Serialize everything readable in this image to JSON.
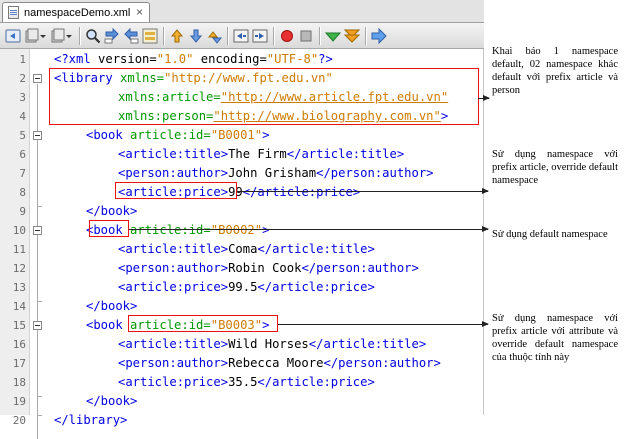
{
  "tab": {
    "title": "namespaceDemo.xml",
    "close": "×"
  },
  "toolbar": {
    "icons": [
      "back-icon",
      "history-icon",
      "forward-icon",
      "find-icon",
      "prev-occurrence-icon",
      "next-occurrence-icon",
      "toggle-selection-icon",
      "prev-bookmark-icon",
      "next-bookmark-icon",
      "toggle-bookmark-icon",
      "shift-left-icon",
      "shift-right-icon",
      "record-macro-icon",
      "stop-macro-icon",
      "check-xml-icon",
      "validate-xml-icon",
      "xsl-transform-icon"
    ]
  },
  "code": {
    "line_numbers": [
      "1",
      "2",
      "3",
      "4",
      "5",
      "6",
      "7",
      "8",
      "9",
      "10",
      "11",
      "12",
      "13",
      "14",
      "15",
      "16",
      "17",
      "18",
      "19",
      "20"
    ],
    "l1": {
      "t1": "<?xml",
      "p1": " version=",
      "v1": "\"1.0\"",
      "p2": " encoding=",
      "v2": "\"UTF-8\"",
      "t2": "?>"
    },
    "l2": {
      "t1": "<library",
      "a1": " xmlns=",
      "v1": "\"http://www.fpt.edu.vn\""
    },
    "l3": {
      "a1": "xmlns:article=",
      "v1": "\"http://www.article.fpt.edu.vn\""
    },
    "l4": {
      "a1": "xmlns:person=",
      "v1": "\"http://www.biolography.com.vn\"",
      "t1": ">"
    },
    "l5": {
      "t1": "<book",
      "a1": " article:id=",
      "v1": "\"B0001\"",
      "t2": ">"
    },
    "l6": {
      "t1": "<article:title>",
      "p1": "The Firm",
      "t2": "</article:title>"
    },
    "l7": {
      "t1": "<person:author>",
      "p1": "John Grisham",
      "t2": "</person:author>"
    },
    "l8": {
      "t1": "<article:price>",
      "p1": "99",
      "t2": "</article:price>"
    },
    "l9": {
      "t1": "</book>"
    },
    "l10": {
      "t1": "<book",
      "a1": " article:id=",
      "v1": "\"B0002\"",
      "t2": ">"
    },
    "l11": {
      "t1": "<article:title>",
      "p1": "Coma",
      "t2": "</article:title>"
    },
    "l12": {
      "t1": "<person:author>",
      "p1": "Robin Cook",
      "t2": "</person:author>"
    },
    "l13": {
      "t1": "<article:price>",
      "p1": "99.5",
      "t2": "</article:price>"
    },
    "l14": {
      "t1": "</book>"
    },
    "l15": {
      "t1": "<book",
      "a1": " article:id=",
      "v1": "\"B0003\"",
      "t2": ">"
    },
    "l16": {
      "t1": "<article:title>",
      "p1": "Wild Horses",
      "t2": "</article:title>"
    },
    "l17": {
      "t1": "<person:author>",
      "p1": "Rebecca Moore",
      "t2": "</person:author>"
    },
    "l18": {
      "t1": "<article:price>",
      "p1": "35.5",
      "t2": "</article:price>"
    },
    "l19": {
      "t1": "</book>"
    },
    "l20": {
      "t1": "</library>"
    }
  },
  "annotations": {
    "note1": "Khai báo 1 namespace default, 02 namespace khác default với prefix article và person",
    "note2": "Sử dụng namespace với prefix article, override default namespace",
    "note3": "Sử dụng default namespace",
    "note4": "Sử dụng namespace với prefix article với attribute và override default namespace của thuộc tính này"
  },
  "colors": {
    "tag": "#0000e6",
    "attribute": "#009900",
    "value": "#ce7b00",
    "highlight": "#ee1111"
  }
}
